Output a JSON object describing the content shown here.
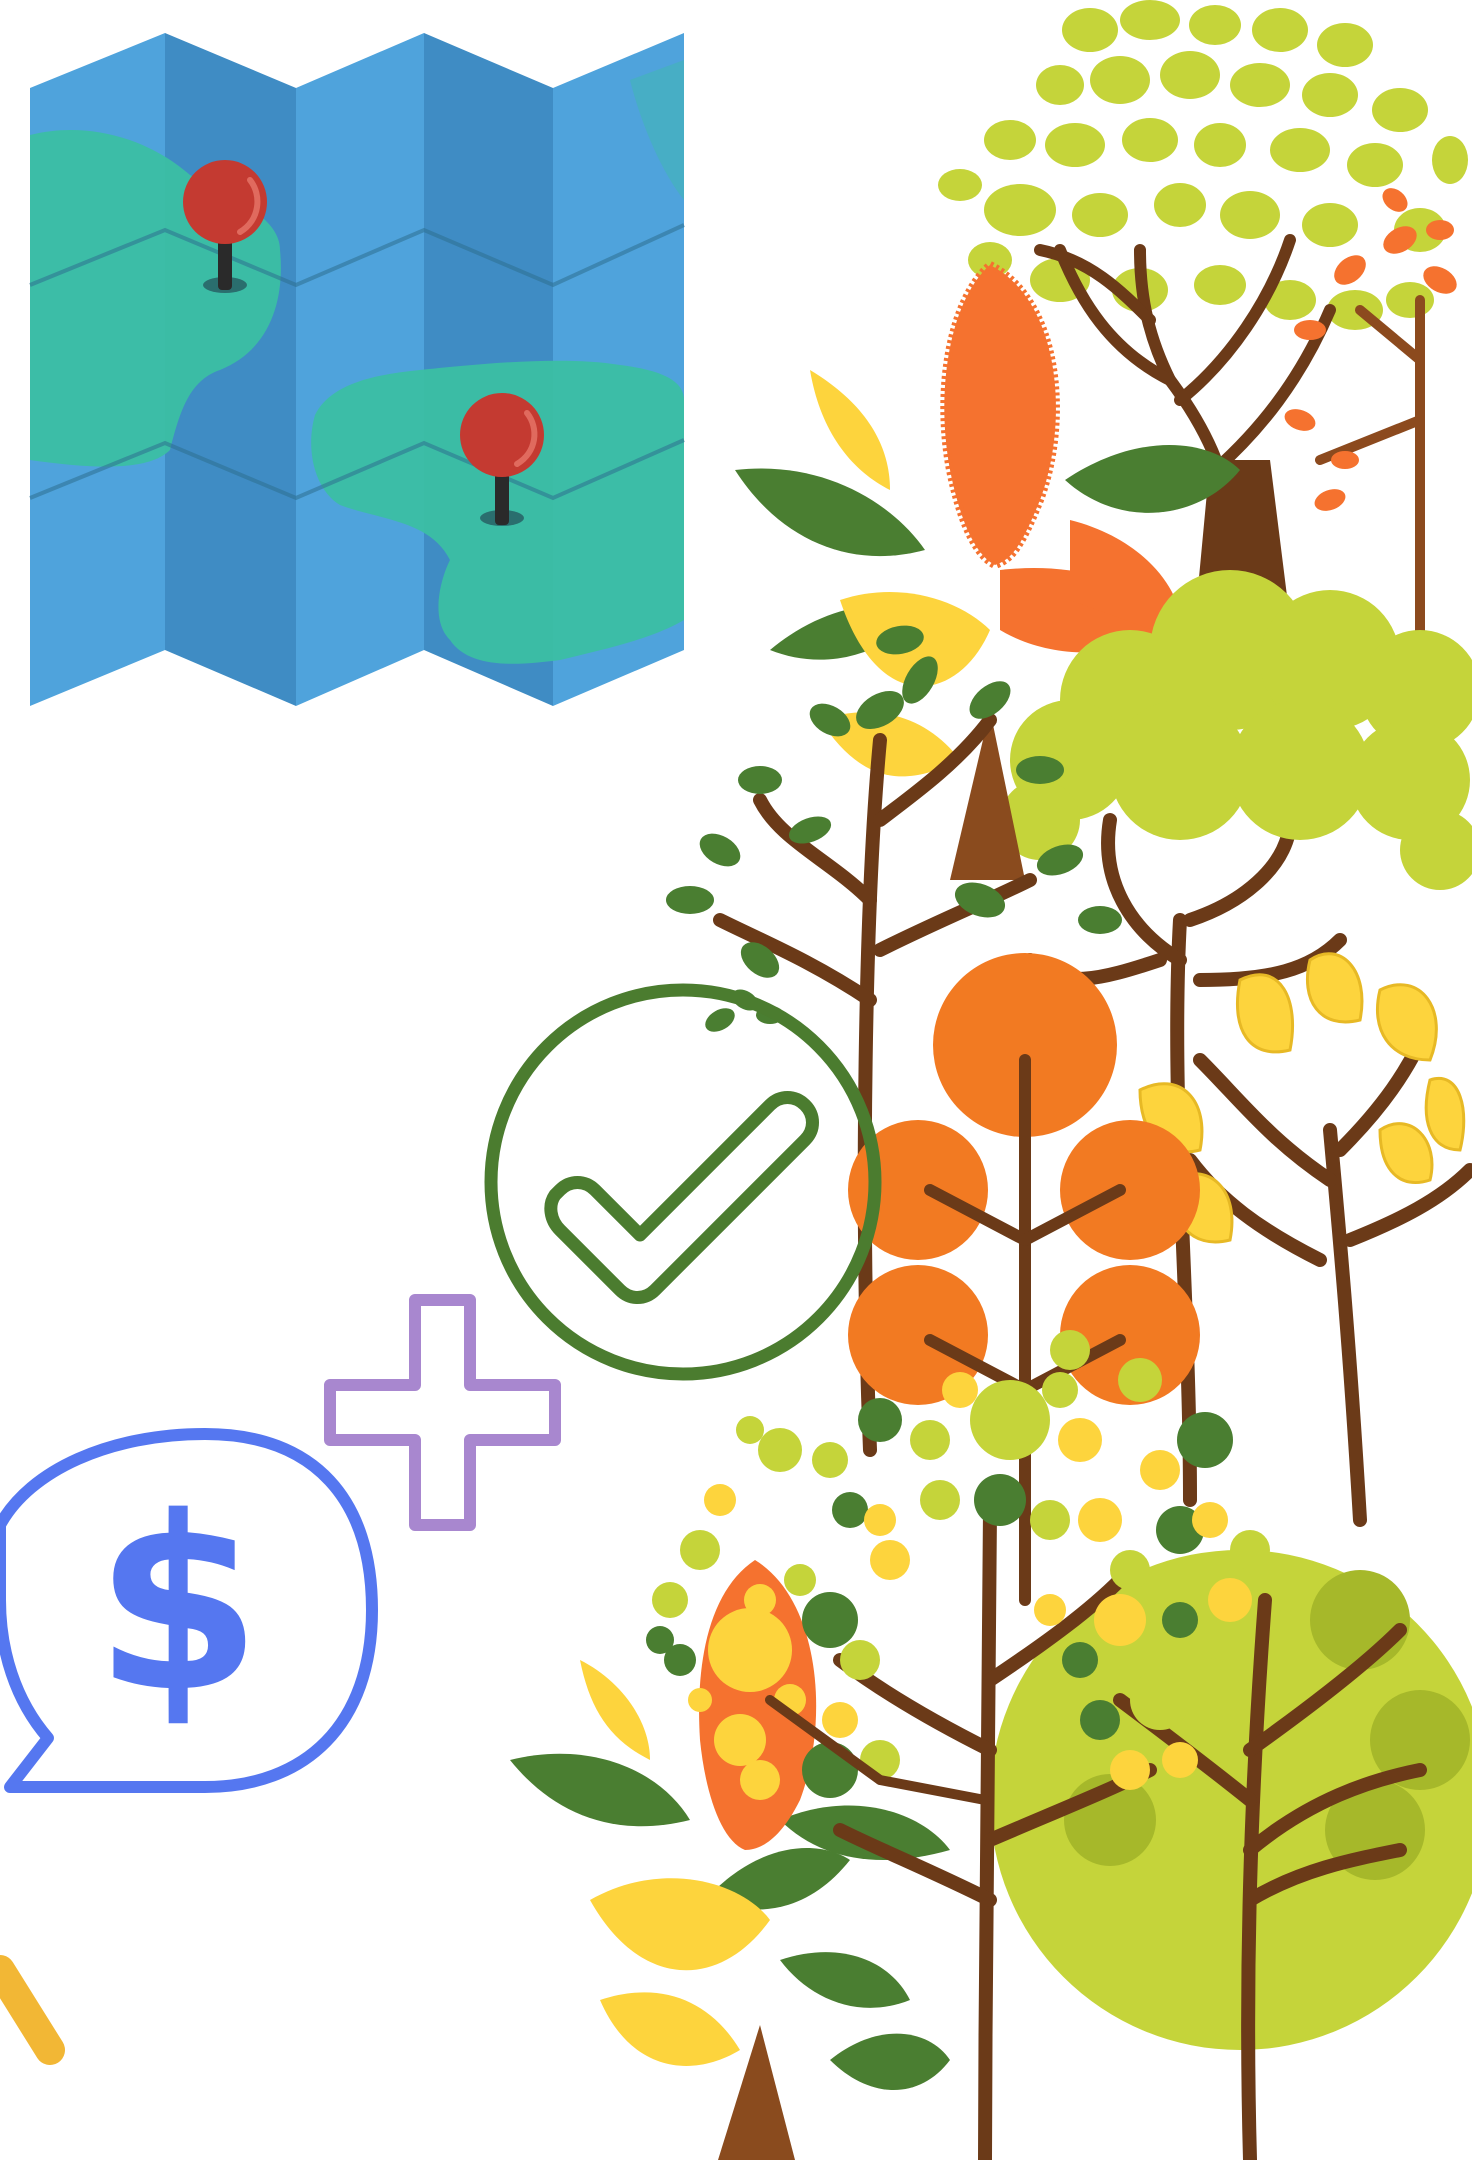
{
  "icons": {
    "map": "folded-map-icon",
    "pins": [
      "map-pin-icon",
      "map-pin-icon"
    ],
    "check": "check-circle-icon",
    "plus": "plus-icon",
    "money_bubble": "dollar-chat-bubble-icon",
    "magnifier": "magnifier-handle-icon",
    "trees": "autumn-trees-illustration"
  },
  "money_bubble": {
    "symbol": "$"
  },
  "colors": {
    "map_blue": "#4fa3dc",
    "map_blue_dark": "#3f8cc4",
    "land_green": "#3bbfa3",
    "pin_red": "#c43a31",
    "check_green": "#4b7c2f",
    "plus_purple": "#a887cf",
    "dollar_blue": "#5577f0",
    "magnifier_yellow": "#f2b735",
    "leaf_lime": "#c5d43a",
    "leaf_orange": "#f5722f",
    "leaf_yellow": "#fdd43d",
    "leaf_green": "#4a7e31",
    "trunk_brown": "#6b3a18"
  }
}
